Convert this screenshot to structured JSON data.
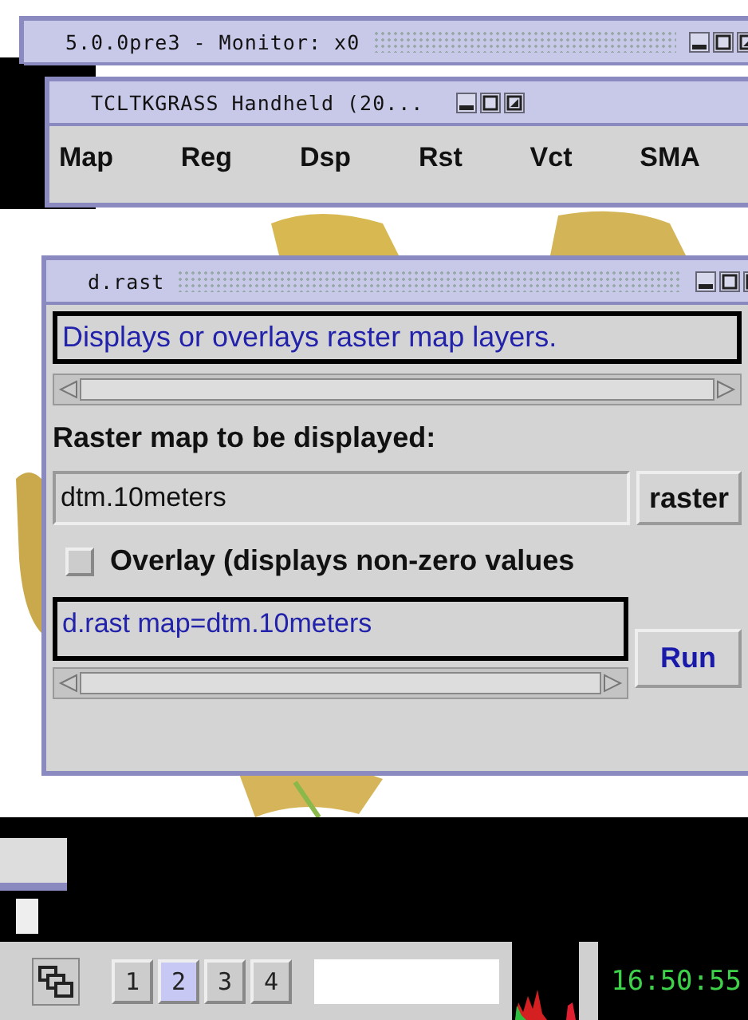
{
  "monitor_window": {
    "title": "5.0.0pre3 - Monitor: x0"
  },
  "handheld_window": {
    "title": "TCLTKGRASS Handheld (20...",
    "menu": [
      {
        "label": "Map"
      },
      {
        "label": "Reg"
      },
      {
        "label": "Dsp"
      },
      {
        "label": "Rst"
      },
      {
        "label": "Vct"
      },
      {
        "label": "SMA"
      }
    ]
  },
  "drast_window": {
    "title": "d.rast",
    "description": "Displays or overlays raster map layers.",
    "map_label": "Raster map to be displayed:",
    "map_field": {
      "value": "dtm.10meters"
    },
    "raster_button": "raster",
    "overlay": {
      "label": "Overlay (displays non-zero values",
      "checked": false
    },
    "command": "d.rast map=dtm.10meters",
    "run_button": "Run"
  },
  "taskbar": {
    "desktops": [
      {
        "label": "1",
        "selected": false
      },
      {
        "label": "2",
        "selected": true
      },
      {
        "label": "3",
        "selected": false
      },
      {
        "label": "4",
        "selected": false
      }
    ],
    "clock": "16:50:55"
  }
}
